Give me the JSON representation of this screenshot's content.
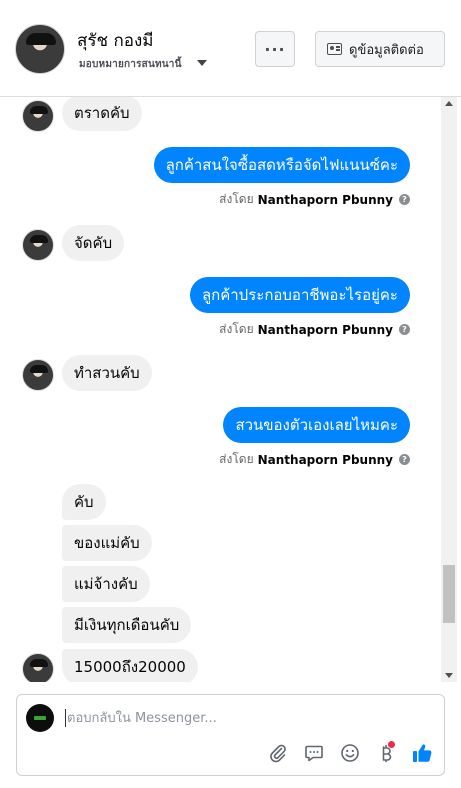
{
  "header": {
    "name": "สุรัช กองมี",
    "subtitle": "มอบหมายการสนทนานี้",
    "more_label": "···",
    "contact_label": "ดูข้อมูลติดต่อ"
  },
  "thread": {
    "sent_by_prefix": "ส่งโดย",
    "sender": "Nanthaporn Pbunny",
    "help_glyph": "?",
    "messages": [
      {
        "from": "customer",
        "text": "ตราดคับ"
      },
      {
        "from": "page",
        "text": "ลูกค้าสนใจซื้อสดหรือจัดไฟแนนซ์คะ"
      },
      {
        "from": "customer",
        "text": "จัดคับ"
      },
      {
        "from": "page",
        "text": "ลูกค้าประกอบอาชีพอะไรอยู่คะ"
      },
      {
        "from": "customer",
        "text": "ทำสวนคับ"
      },
      {
        "from": "page",
        "text": "สวนของตัวเองเลยไหมคะ"
      },
      {
        "from": "customer",
        "text": "คับ"
      },
      {
        "from": "customer",
        "text": "ของแม่คับ"
      },
      {
        "from": "customer",
        "text": "แม่จ้างคับ"
      },
      {
        "from": "customer",
        "text": "มีเงินทุกเดือนคับ"
      },
      {
        "from": "customer",
        "text": "15000ถึง20000"
      }
    ]
  },
  "composer": {
    "placeholder": "ตอบกลับใน Messenger...",
    "value": "",
    "tools": [
      "attach-icon",
      "saved-reply-icon",
      "emoji-icon",
      "baht-payment-icon",
      "thumbs-up-icon"
    ]
  },
  "colors": {
    "outgoing_bubble": "#0084ff",
    "incoming_bubble": "#f0f0f0",
    "like_button": "#0084ff",
    "notification_dot": "#f02849"
  }
}
